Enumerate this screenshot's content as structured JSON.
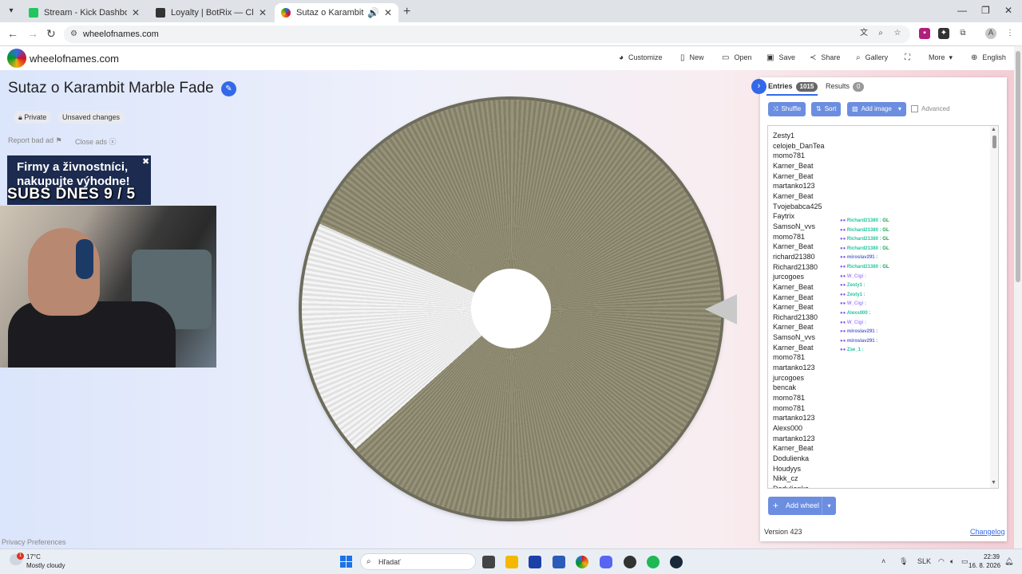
{
  "browser": {
    "tabs": [
      {
        "title": "Stream - Kick Dashboard",
        "favicon_color": "#22c55e"
      },
      {
        "title": "Loyalty | BotRix — Cloud Stream",
        "favicon_color": "#333333"
      },
      {
        "title": "Sutaz o Karambit Marble Fa",
        "favicon_color": "#d50f25"
      }
    ],
    "url": "wheelofnames.com"
  },
  "site": {
    "name": "wheelofnames.com",
    "menu": [
      {
        "label": "Customize",
        "icon": "palette-icon"
      },
      {
        "label": "New",
        "icon": "file-icon"
      },
      {
        "label": "Open",
        "icon": "folder-icon"
      },
      {
        "label": "Save",
        "icon": "save-icon"
      },
      {
        "label": "Share",
        "icon": "share-icon"
      },
      {
        "label": "Gallery",
        "icon": "search-icon"
      },
      {
        "label": "",
        "icon": "fullscreen-icon"
      },
      {
        "label": "More",
        "icon": "chevron-down-icon"
      },
      {
        "label": "English",
        "icon": "globe-icon"
      }
    ]
  },
  "wheel": {
    "title": "Sutaz o Karambit Marble Fade",
    "privacy_chip": "Private",
    "status_chip": "Unsaved changes"
  },
  "ads": {
    "report": "Report bad ad",
    "close": "Close ads",
    "line1": "Firmy a živnostníci,",
    "line2": "nakupujte výhodne!"
  },
  "overlay": {
    "text": "SUBS DNES 9 / 5"
  },
  "privacy_link": "Privacy Preferences",
  "panel": {
    "entries_tab": "Entries",
    "entries_count": "1015",
    "results_tab": "Results",
    "results_count": "0",
    "shuffle": "Shuffle",
    "sort": "Sort",
    "add_image": "Add image",
    "advanced": "Advanced",
    "entries": [
      "Zesty1",
      "celojeb_DanTea",
      "momo781",
      "Karner_Beat",
      "Karner_Beat",
      "martanko123",
      "Karner_Beat",
      "Tvojebabca425",
      "Faytrix",
      "SamsoN_vvs",
      "momo781",
      "Karner_Beat",
      "richard21380",
      "Richard21380",
      "jurcogoes",
      "Karner_Beat",
      "Karner_Beat",
      "Karner_Beat",
      "Richard21380",
      "Karner_Beat",
      "SamsoN_vvs",
      "Karner_Beat",
      "momo781",
      "martanko123",
      "jurcogoes",
      "bencak",
      "momo781",
      "momo781",
      "martanko123",
      "Alexs000",
      "martanko123",
      "Karner_Beat",
      "Dodulienka",
      "Houdyys",
      "Nikk_cz",
      "Dodulienka"
    ],
    "chat": [
      {
        "user": "Richard21380",
        "msg": "GL",
        "color": "#22c59e"
      },
      {
        "user": "Richard21380",
        "msg": "GL",
        "color": "#22c59e"
      },
      {
        "user": "Richard21380",
        "msg": "GL",
        "color": "#22c59e"
      },
      {
        "user": "Richard21380",
        "msg": "GL",
        "color": "#22c59e"
      },
      {
        "user": "miroslav291",
        "msg": "",
        "color": "#5b6bd1"
      },
      {
        "user": "Richard21380",
        "msg": "GL",
        "color": "#22c59e"
      },
      {
        "user": "W_Cigi",
        "msg": "",
        "color": "#a78bfa"
      },
      {
        "user": "Zesty1",
        "msg": "",
        "color": "#22c59e"
      },
      {
        "user": "Zesty1",
        "msg": "",
        "color": "#22c59e"
      },
      {
        "user": "W_Cigi",
        "msg": "",
        "color": "#a78bfa"
      },
      {
        "user": "Alexs000",
        "msg": "",
        "color": "#22c59e"
      },
      {
        "user": "W_Cigi",
        "msg": "",
        "color": "#a78bfa"
      },
      {
        "user": "miroslav291",
        "msg": "",
        "color": "#5b6bd1"
      },
      {
        "user": "miroslav291",
        "msg": "",
        "color": "#5b6bd1"
      },
      {
        "user": "Zse_1",
        "msg": "",
        "color": "#22c59e"
      }
    ],
    "add_wheel": "Add wheel",
    "version": "Version 423",
    "changelog": "Changelog"
  },
  "taskbar": {
    "temp": "17°C",
    "condition": "Mostly cloudy",
    "search_placeholder": "Hľadať",
    "lang": "SLK",
    "time": "22:39",
    "date": "16. 8. 2026"
  }
}
